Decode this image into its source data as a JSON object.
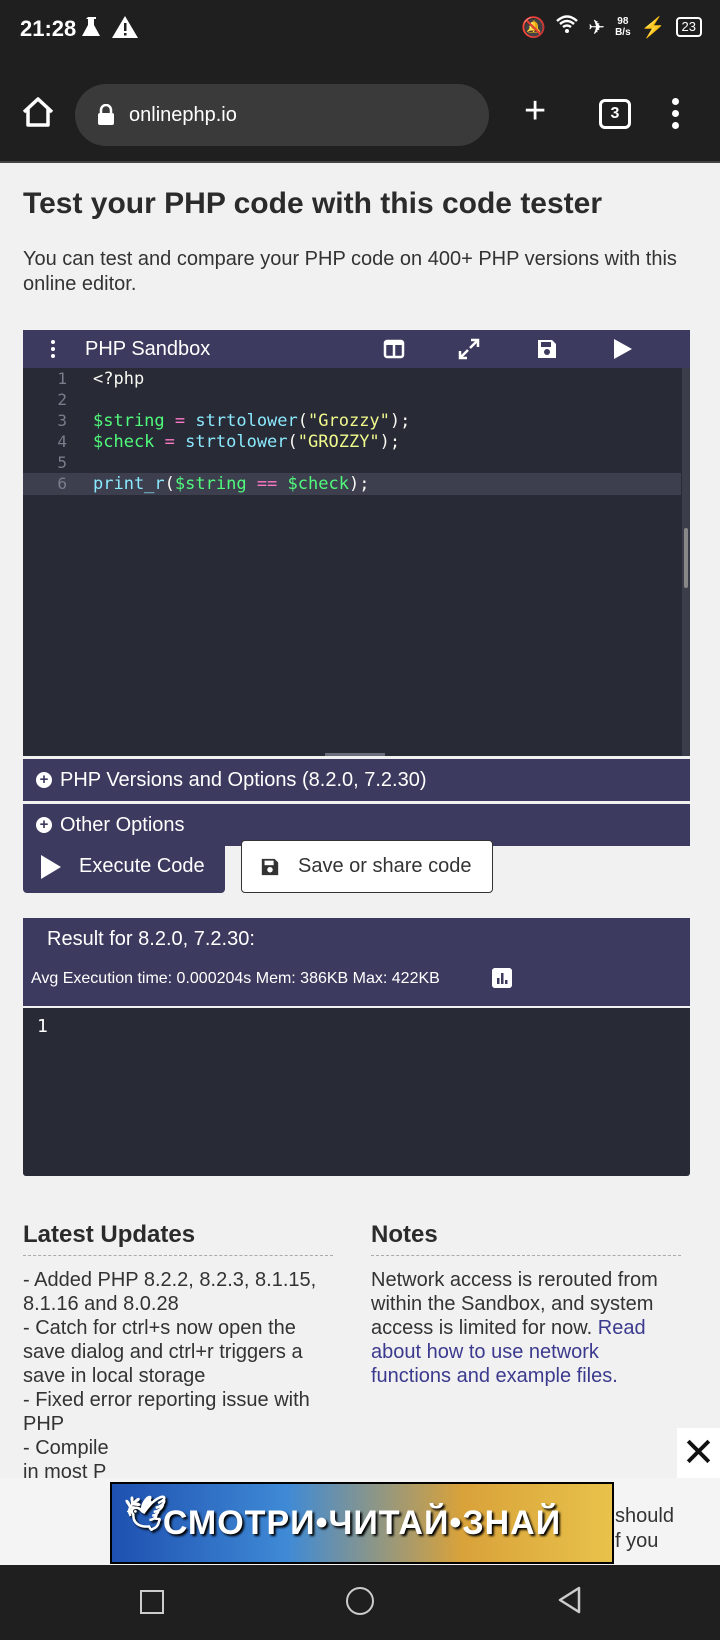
{
  "status": {
    "time": "21:28",
    "net_speed_top": "98",
    "net_speed_bottom": "B/s",
    "battery": "23"
  },
  "browser": {
    "url": "onlinephp.io",
    "tab_count": "3"
  },
  "page": {
    "title": "Test your PHP code with this code tester",
    "intro": "You can test and compare your PHP code on 400+ PHP versions with this online editor."
  },
  "sandbox": {
    "title": "PHP Sandbox",
    "lines": [
      {
        "n": "1",
        "text": "<?php"
      },
      {
        "n": "2",
        "text": ""
      },
      {
        "n": "3",
        "text": "$string = strtolower(\"Grozzy\");"
      },
      {
        "n": "4",
        "text": "$check = strtolower(\"GROZZY\");"
      },
      {
        "n": "5",
        "text": ""
      },
      {
        "n": "6",
        "text": "print_r($string == $check);"
      }
    ],
    "versions_label": "PHP Versions and Options (8.2.0, 7.2.30)",
    "other_label": "Other Options"
  },
  "buttons": {
    "execute": "Execute Code",
    "save": "Save or share code"
  },
  "result": {
    "title": "Result for 8.2.0, 7.2.30:",
    "stats": "Avg Execution time: 0.000204s Mem: 386KB Max: 422KB",
    "output": "1"
  },
  "updates": {
    "heading": "Latest Updates",
    "text": "- Added PHP 8.2.2, 8.2.3, 8.1.15, 8.1.16 and 8.0.28\n- Catch for ctrl+s now open the save dialog and ctrl+r triggers a save in local storage\n- Fixed error reporting issue with PHP\n- Compile\nin most P"
  },
  "notes": {
    "heading": "Notes",
    "text": "Network access is rerouted from within the Sandbox, and system access is limited for now. ",
    "link": "Read about how to use network functions and example files.",
    "trailing1": "should",
    "trailing2": "f you"
  },
  "ad": {
    "text": "СМОТРИ•ЧИТАЙ•ЗНАЙ"
  }
}
